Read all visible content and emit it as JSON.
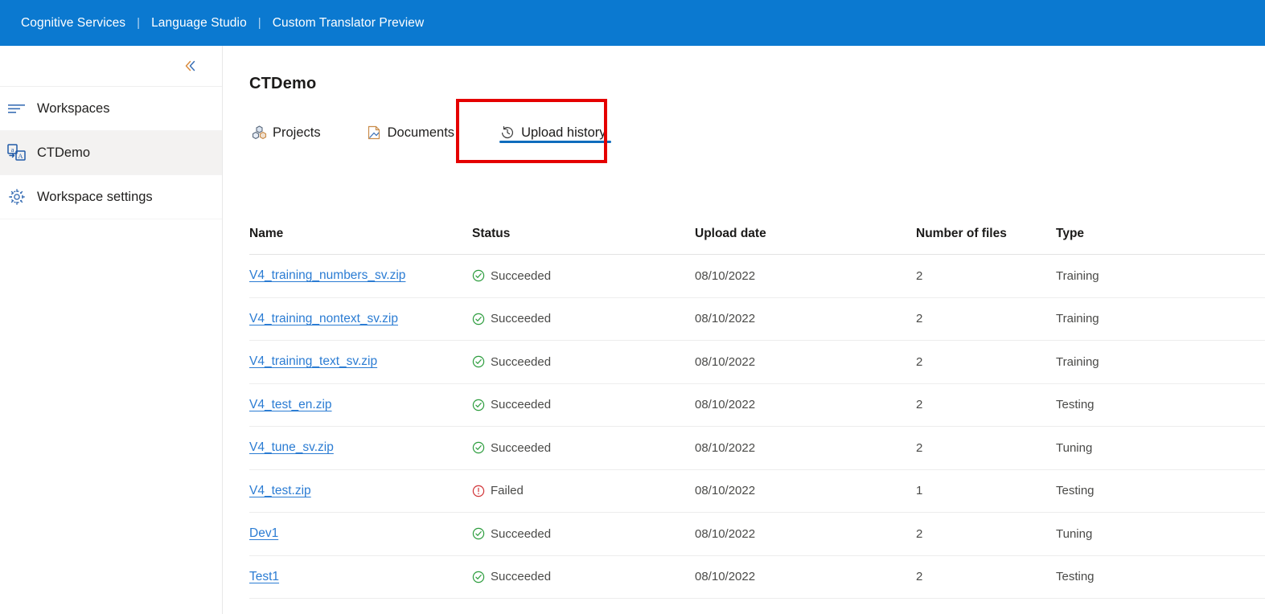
{
  "topbar": {
    "breadcrumbs": [
      "Cognitive Services",
      "Language Studio",
      "Custom Translator Preview"
    ],
    "separator": "|",
    "background_color": "#0b79d0"
  },
  "sidebar": {
    "collapse_icon": "chevron-double-left-icon",
    "items": [
      {
        "label": "Workspaces",
        "icon": "workspaces-list-icon",
        "selected": false
      },
      {
        "label": "CTDemo",
        "icon": "translate-icon",
        "selected": true
      },
      {
        "label": "Workspace settings",
        "icon": "gear-icon",
        "selected": false
      }
    ]
  },
  "main": {
    "title": "CTDemo",
    "tabs": [
      {
        "label": "Projects",
        "icon": "projects-cubes-icon",
        "active": false
      },
      {
        "label": "Documents",
        "icon": "document-icon",
        "active": false
      },
      {
        "label": "Upload history",
        "icon": "history-clock-icon",
        "active": true
      }
    ],
    "annotation": {
      "type": "highlight-rectangle",
      "color": "#e50000",
      "target": "Upload history"
    },
    "table": {
      "columns": [
        "Name",
        "Status",
        "Upload date",
        "Number of files",
        "Type"
      ],
      "rows": [
        {
          "name": "V4_training_numbers_sv.zip",
          "status": "Succeeded",
          "status_icon": "check-circle-icon",
          "date": "08/10/2022",
          "files": "2",
          "type": "Training"
        },
        {
          "name": "V4_training_nontext_sv.zip",
          "status": "Succeeded",
          "status_icon": "check-circle-icon",
          "date": "08/10/2022",
          "files": "2",
          "type": "Training"
        },
        {
          "name": "V4_training_text_sv.zip",
          "status": "Succeeded",
          "status_icon": "check-circle-icon",
          "date": "08/10/2022",
          "files": "2",
          "type": "Training"
        },
        {
          "name": "V4_test_en.zip",
          "status": "Succeeded",
          "status_icon": "check-circle-icon",
          "date": "08/10/2022",
          "files": "2",
          "type": "Testing"
        },
        {
          "name": "V4_tune_sv.zip",
          "status": "Succeeded",
          "status_icon": "check-circle-icon",
          "date": "08/10/2022",
          "files": "2",
          "type": "Tuning"
        },
        {
          "name": "V4_test.zip",
          "status": "Failed",
          "status_icon": "error-circle-icon",
          "date": "08/10/2022",
          "files": "1",
          "type": "Testing"
        },
        {
          "name": "Dev1",
          "status": "Succeeded",
          "status_icon": "check-circle-icon",
          "date": "08/10/2022",
          "files": "2",
          "type": "Tuning"
        },
        {
          "name": "Test1",
          "status": "Succeeded",
          "status_icon": "check-circle-icon",
          "date": "08/10/2022",
          "files": "2",
          "type": "Testing"
        }
      ]
    }
  },
  "colors": {
    "brand_blue": "#0b79d0",
    "link_blue": "#2b7cd3",
    "tab_accent": "#0f6cbd",
    "success_green": "#107c10",
    "error_red": "#d13438",
    "annotation_red": "#e50000",
    "selected_row_bg": "#f3f2f1"
  }
}
